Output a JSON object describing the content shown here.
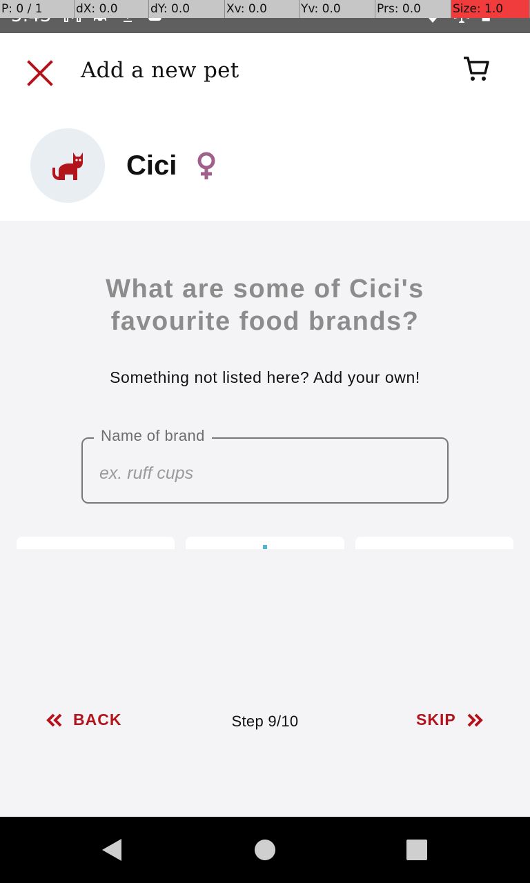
{
  "status_bar": {
    "time": "5:43",
    "overlay": {
      "p": "P: 0 / 1",
      "dx": "dX: 0.0",
      "dy": "dY: 0.0",
      "xv": "Xv: 0.0",
      "yv": "Yv: 0.0",
      "prs": "Prs: 0.0",
      "size": "Size: 1.0"
    },
    "icons": [
      "gmail-icon",
      "car-icon",
      "download-icon",
      "cloud-icon",
      "dot-icon",
      "wifi-icon",
      "airplane-icon",
      "battery-icon"
    ]
  },
  "app_bar": {
    "title": "Add a new pet",
    "close_icon": "close-icon",
    "cart_icon": "cart-icon"
  },
  "pet": {
    "name": "Cici",
    "avatar_icon": "cat-icon",
    "gender_icon": "female-icon"
  },
  "content": {
    "question": "What are some of Cici's favourite food brands?",
    "hint": "Something not listed here? Add your own!",
    "brand_field": {
      "label": "Name of brand",
      "placeholder": "ex. ruff cups",
      "value": ""
    }
  },
  "footer": {
    "back_label": "BACK",
    "step_label": "Step 9/10",
    "skip_label": "SKIP"
  },
  "colors": {
    "accent": "#b3141c",
    "question": "#8c8c8c",
    "female": "#a0608c",
    "background": "#f4f4f6"
  }
}
